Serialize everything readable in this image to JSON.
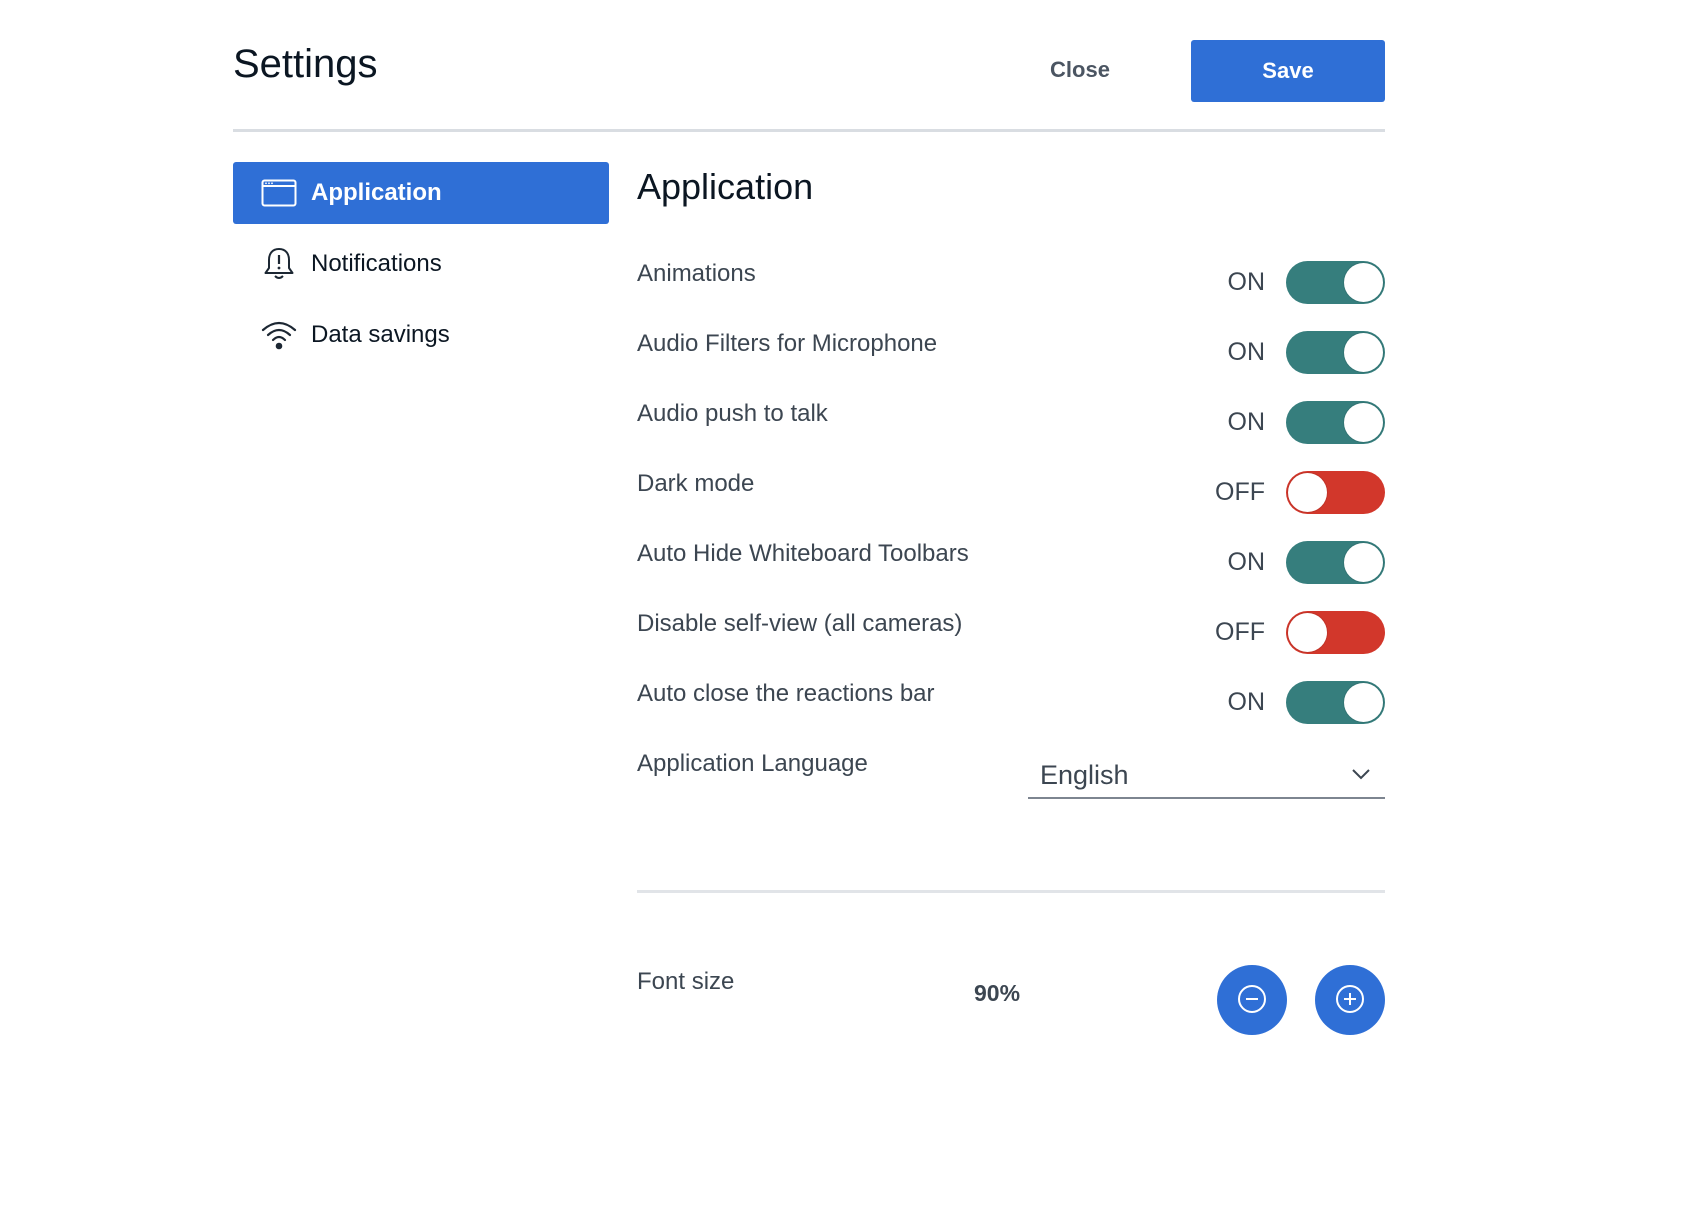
{
  "header": {
    "title": "Settings",
    "close_label": "Close",
    "save_label": "Save"
  },
  "sidebar": {
    "items": [
      {
        "label": "Application",
        "icon": "window-icon",
        "active": true
      },
      {
        "label": "Notifications",
        "icon": "bell-alert-icon",
        "active": false
      },
      {
        "label": "Data savings",
        "icon": "wifi-icon",
        "active": false
      }
    ]
  },
  "main": {
    "title": "Application",
    "settings": [
      {
        "label": "Animations",
        "state": "ON",
        "enabled": true
      },
      {
        "label": "Audio Filters for Microphone",
        "state": "ON",
        "enabled": true
      },
      {
        "label": "Audio push to talk",
        "state": "ON",
        "enabled": true
      },
      {
        "label": "Dark mode",
        "state": "OFF",
        "enabled": false
      },
      {
        "label": "Auto Hide Whiteboard Toolbars",
        "state": "ON",
        "enabled": true
      },
      {
        "label": "Disable self-view (all cameras)",
        "state": "OFF",
        "enabled": false
      },
      {
        "label": "Auto close the reactions bar",
        "state": "ON",
        "enabled": true
      }
    ],
    "language": {
      "label": "Application Language",
      "value": "English"
    },
    "font_size": {
      "label": "Font size",
      "value": "90%"
    }
  },
  "colors": {
    "accent": "#2f6fd6",
    "toggle_on": "#367e7d",
    "toggle_off": "#d2372b"
  }
}
